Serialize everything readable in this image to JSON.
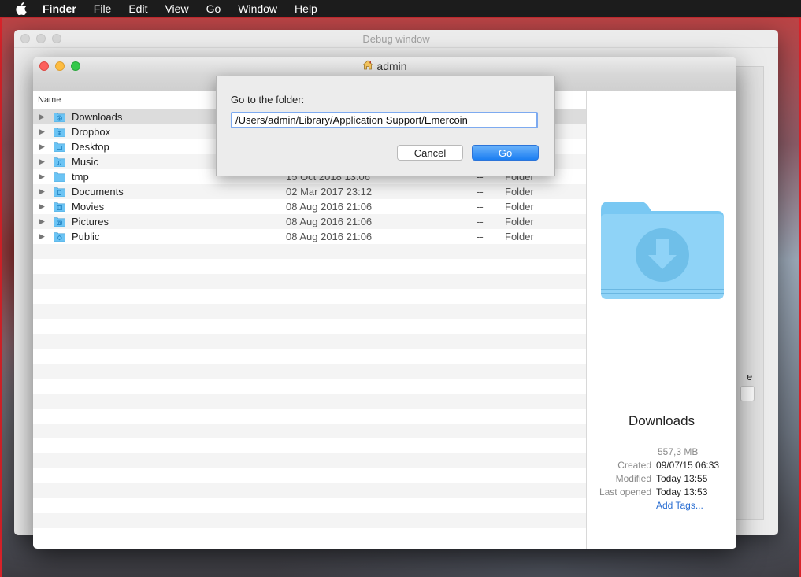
{
  "menubar": {
    "apple_icon": "apple-icon",
    "items": [
      "Finder",
      "File",
      "Edit",
      "View",
      "Go",
      "Window",
      "Help"
    ]
  },
  "debug_window": {
    "title": "Debug window",
    "stub_text": "e"
  },
  "finder": {
    "title": "admin",
    "title_icon": "home-icon",
    "column_header": "Name",
    "rows": [
      {
        "name": "Downloads",
        "icon": "downloads-folder-icon",
        "date": "",
        "size": "",
        "kind": "",
        "selected": true
      },
      {
        "name": "Dropbox",
        "icon": "dropbox-folder-icon",
        "date": "",
        "size": "",
        "kind": ""
      },
      {
        "name": "Desktop",
        "icon": "desktop-folder-icon",
        "date": "",
        "size": "",
        "kind": ""
      },
      {
        "name": "Music",
        "icon": "music-folder-icon",
        "date": "",
        "size": "",
        "kind": ""
      },
      {
        "name": "tmp",
        "icon": "folder-icon",
        "date": "15 Oct 2018 13:06",
        "size": "--",
        "kind": "Folder"
      },
      {
        "name": "Documents",
        "icon": "documents-folder-icon",
        "date": "02 Mar 2017 23:12",
        "size": "--",
        "kind": "Folder"
      },
      {
        "name": "Movies",
        "icon": "movies-folder-icon",
        "date": "08 Aug 2016 21:06",
        "size": "--",
        "kind": "Folder"
      },
      {
        "name": "Pictures",
        "icon": "pictures-folder-icon",
        "date": "08 Aug 2016 21:06",
        "size": "--",
        "kind": "Folder"
      },
      {
        "name": "Public",
        "icon": "public-folder-icon",
        "date": "08 Aug 2016 21:06",
        "size": "--",
        "kind": "Folder"
      }
    ],
    "preview": {
      "name": "Downloads",
      "size": "557,3 MB",
      "created_label": "Created",
      "created": "09/07/15 06:33",
      "modified_label": "Modified",
      "modified": "Today 13:55",
      "opened_label": "Last opened",
      "opened": "Today 13:53",
      "add_tags": "Add Tags..."
    }
  },
  "goto_sheet": {
    "label": "Go to the folder:",
    "path": "/Users/admin/Library/Application Support/Emercoin",
    "cancel_label": "Cancel",
    "go_label": "Go"
  },
  "colors": {
    "folder_blue": "#6cc4f4",
    "accent": "#1b7ef2",
    "link": "#2a6ed2"
  }
}
